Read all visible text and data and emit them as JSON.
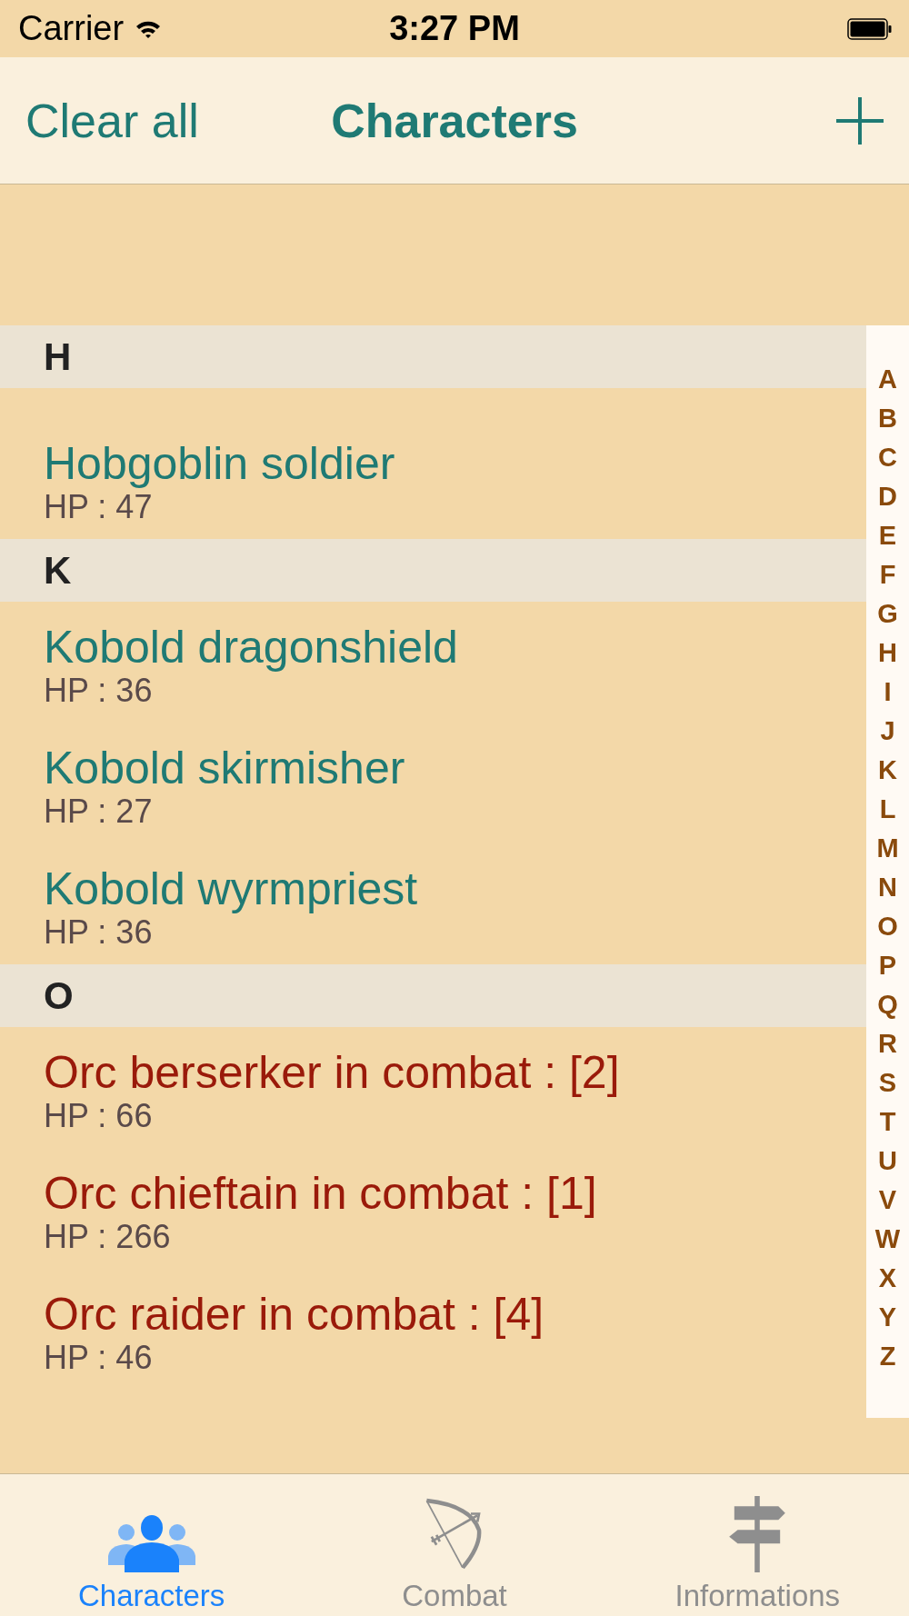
{
  "status_bar": {
    "carrier": "Carrier",
    "time": "3:27 PM"
  },
  "nav": {
    "left_button": "Clear all",
    "title": "Characters"
  },
  "list": {
    "sections": [
      {
        "letter": "H",
        "items": [
          {
            "name": "Hobgoblin soldier",
            "hp": "HP : 47",
            "in_combat": false
          }
        ]
      },
      {
        "letter": "K",
        "items": [
          {
            "name": "Kobold dragonshield",
            "hp": "HP : 36",
            "in_combat": false
          },
          {
            "name": "Kobold skirmisher",
            "hp": "HP : 27",
            "in_combat": false
          },
          {
            "name": "Kobold wyrmpriest",
            "hp": "HP : 36",
            "in_combat": false
          }
        ]
      },
      {
        "letter": "O",
        "items": [
          {
            "name": "Orc berserker in combat : [2]",
            "hp": "HP : 66",
            "in_combat": true
          },
          {
            "name": "Orc chieftain in combat : [1]",
            "hp": "HP : 266",
            "in_combat": true
          },
          {
            "name": "Orc raider in combat : [4]",
            "hp": "HP : 46",
            "in_combat": true
          }
        ]
      }
    ]
  },
  "index": [
    "A",
    "B",
    "C",
    "D",
    "E",
    "F",
    "G",
    "H",
    "I",
    "J",
    "K",
    "L",
    "M",
    "N",
    "O",
    "P",
    "Q",
    "R",
    "S",
    "T",
    "U",
    "V",
    "W",
    "X",
    "Y",
    "Z"
  ],
  "tabs": [
    {
      "label": "Characters",
      "kind": "people",
      "selected": true
    },
    {
      "label": "Combat",
      "kind": "bow",
      "selected": false
    },
    {
      "label": "Informations",
      "kind": "signpost",
      "selected": false
    }
  ]
}
